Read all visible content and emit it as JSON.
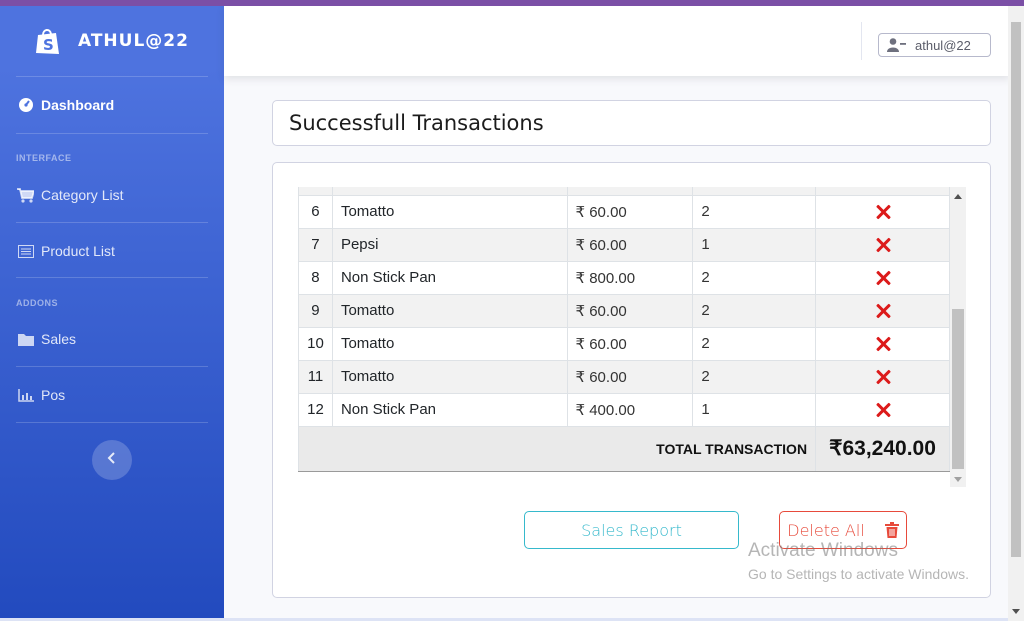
{
  "brand": {
    "name": "ATHUL@22",
    "icon": "shopping-bag-icon"
  },
  "sidebar": {
    "items": [
      {
        "label": "Dashboard",
        "icon": "tachometer-icon",
        "active": true
      },
      {
        "label": "Category List",
        "icon": "cart-icon"
      },
      {
        "label": "Product List",
        "icon": "list-icon"
      },
      {
        "label": "Sales",
        "icon": "folder-icon"
      },
      {
        "label": "Pos",
        "icon": "chart-icon"
      }
    ],
    "headings": [
      "INTERFACE",
      "ADDONS"
    ],
    "toggle_icon": "chevron-left-icon"
  },
  "topbar": {
    "user_label": "athul@22",
    "user_icon": "user-minus-icon"
  },
  "page": {
    "title": "Successfull Transactions"
  },
  "table": {
    "partial_row_text": "",
    "rows": [
      {
        "no": "6",
        "name": "Tomatto",
        "price": "₹ 60.00",
        "qty": "2"
      },
      {
        "no": "7",
        "name": "Pepsi",
        "price": "₹ 60.00",
        "qty": "1"
      },
      {
        "no": "8",
        "name": "Non Stick Pan",
        "price": "₹ 800.00",
        "qty": "2"
      },
      {
        "no": "9",
        "name": "Tomatto",
        "price": "₹ 60.00",
        "qty": "2"
      },
      {
        "no": "10",
        "name": "Tomatto",
        "price": "₹ 60.00",
        "qty": "2"
      },
      {
        "no": "11",
        "name": "Tomatto",
        "price": "₹ 60.00",
        "qty": "2"
      },
      {
        "no": "12",
        "name": "Non Stick Pan",
        "price": "₹ 400.00",
        "qty": "1"
      }
    ],
    "total_label": "TOTAL TRANSACTION",
    "total_value": "₹63,240.00"
  },
  "buttons": {
    "report": "Sales Report",
    "delete_all": "Delete All"
  },
  "watermark": {
    "title": "Activate Windows",
    "subtitle": "Go to Settings to activate Windows."
  },
  "colors": {
    "sidebar_start": "#4e73df",
    "sidebar_end": "#224abe",
    "info": "#36b9cc",
    "danger": "#e74a3b",
    "delete_x": "#dc1a1a"
  }
}
